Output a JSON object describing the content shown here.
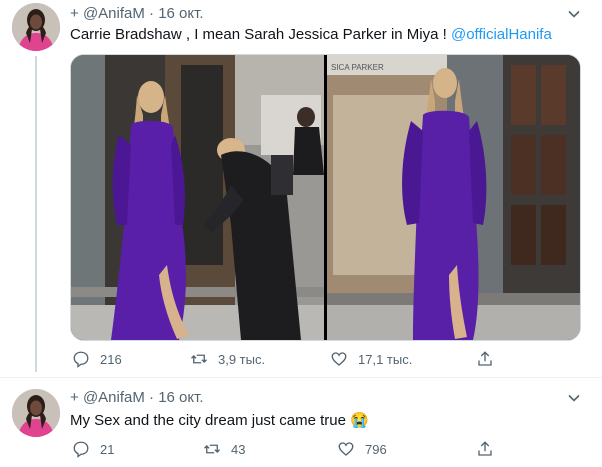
{
  "tweets": [
    {
      "prefix": "+",
      "handle": "@AnifaM",
      "separator": "·",
      "date": "16 окт.",
      "text": "Carrie Bradshaw , I mean Sarah Jessica Parker in Miya ! ",
      "mention": "@officialHanifa",
      "photo_sign": "SICA PARKER",
      "stats": {
        "replies": "216",
        "retweets": "3,9 тыс.",
        "likes": "17,1 тыс."
      }
    },
    {
      "prefix": "+",
      "handle": "@AnifaM",
      "separator": "·",
      "date": "16 окт.",
      "text": "My Sex and the city dream just came true",
      "emoji": "😭",
      "stats": {
        "replies": "21",
        "retweets": "43",
        "likes": "796"
      }
    }
  ],
  "icons": [
    "reply-icon",
    "retweet-icon",
    "like-icon",
    "share-icon",
    "chevron-down-icon"
  ]
}
